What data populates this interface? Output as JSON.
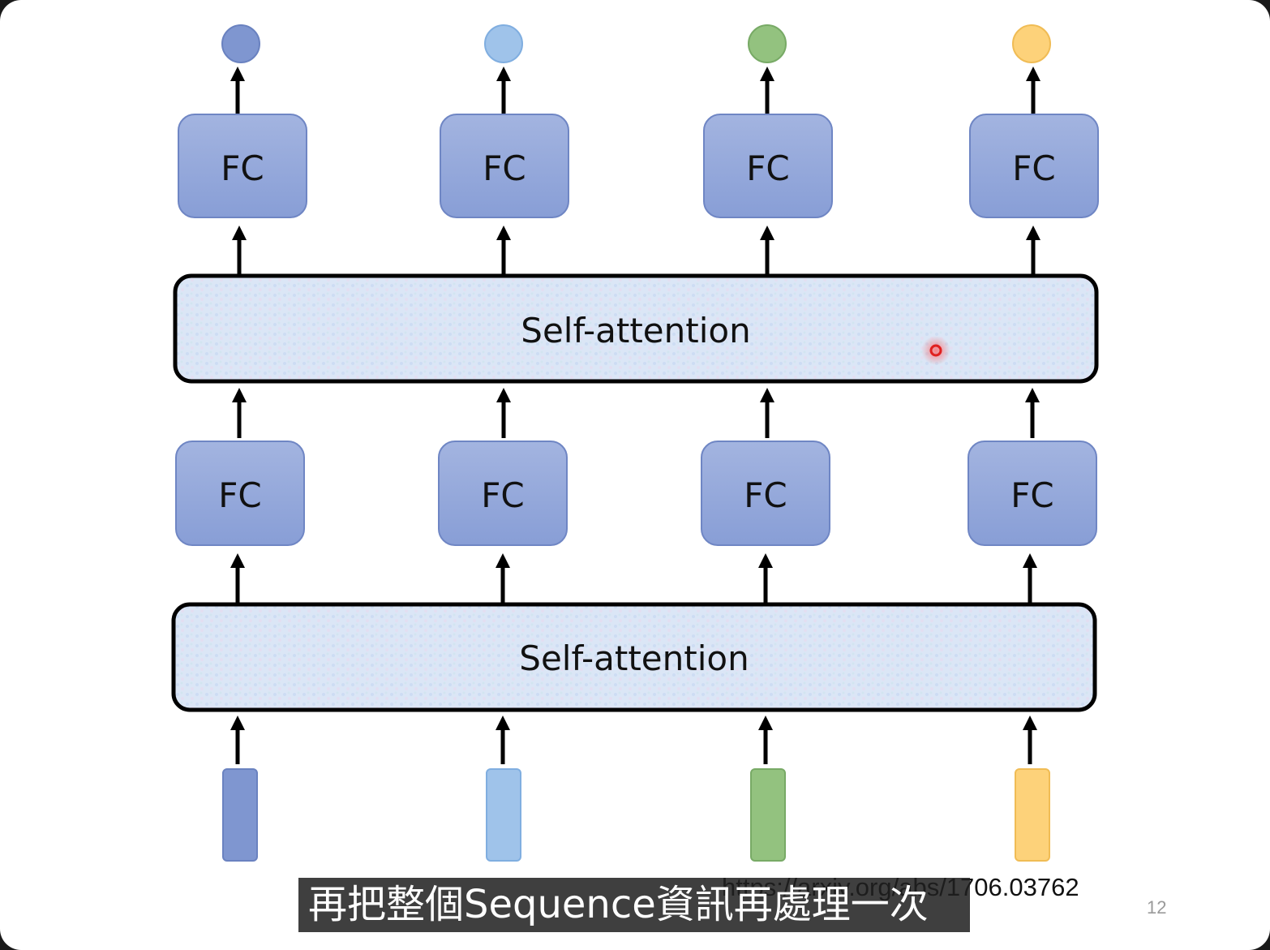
{
  "diagram": {
    "fc_label": "FC",
    "self_attention_upper": "Self-attention",
    "self_attention_lower": "Self-attention",
    "colors": {
      "fc_fill": "#8fa4d9",
      "fc_stroke": "#6f86c4",
      "token_colors": [
        "#7f96d0",
        "#9fc3ea",
        "#93c27f",
        "#fdd27a"
      ],
      "token_strokes": [
        "#6a82c0",
        "#80aee0",
        "#78aa66",
        "#f0bc55"
      ],
      "attention_fill": "#dbe6f6",
      "pointer": "#e0201f"
    }
  },
  "footer": {
    "url": "https://arxiv.org/abs/1706.03762",
    "page_number": "12"
  },
  "subtitle": "再把整個Sequence資訊再處理一次"
}
